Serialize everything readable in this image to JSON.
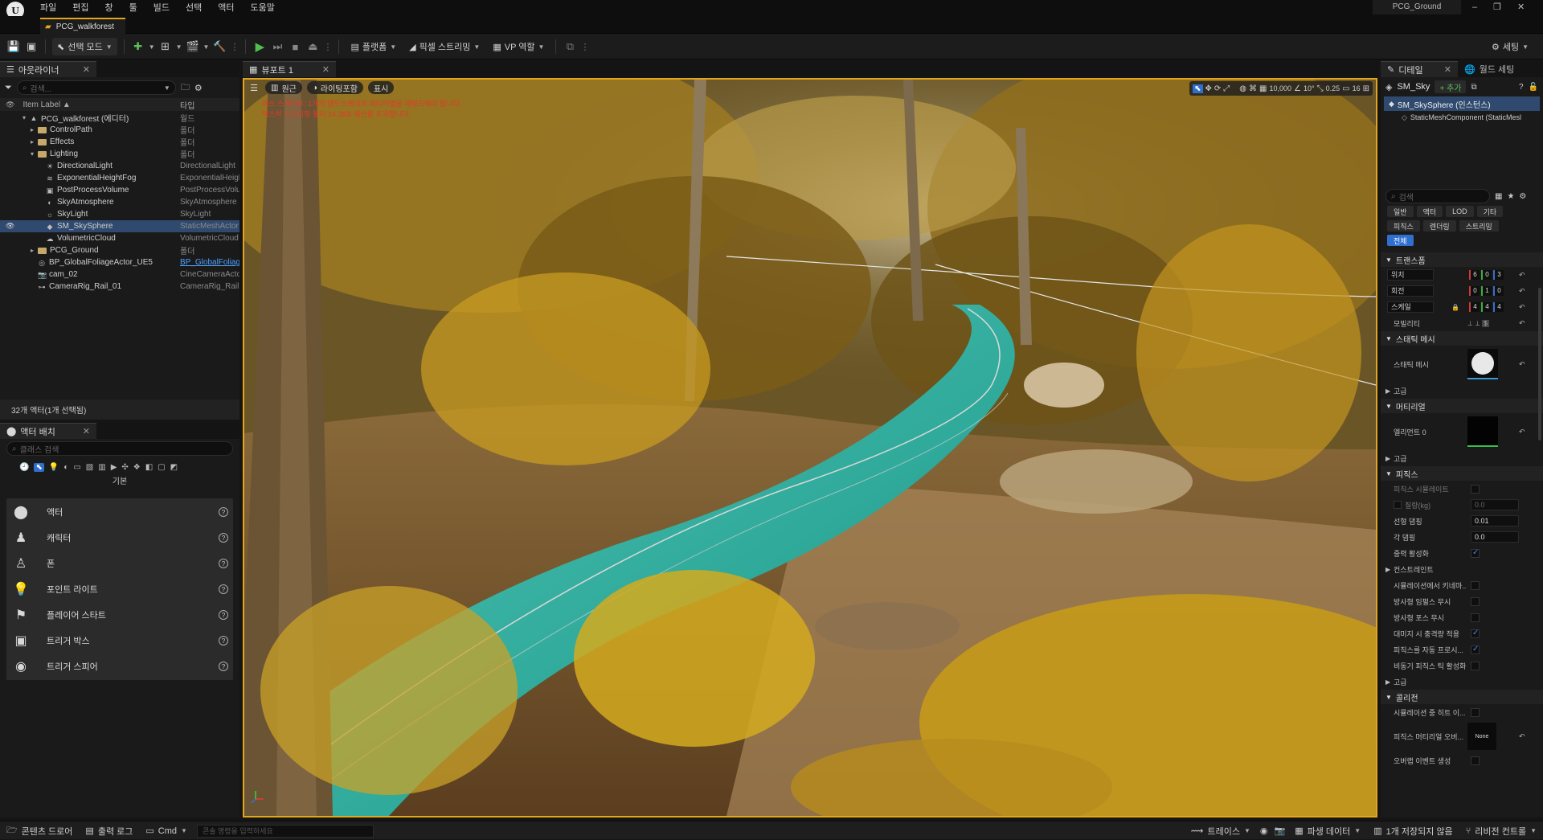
{
  "menu": {
    "items": [
      "파일",
      "편집",
      "창",
      "툴",
      "빌드",
      "선택",
      "액터",
      "도움말"
    ]
  },
  "window": {
    "project_name": "PCG_Ground",
    "level_tab": "PCG_walkforest"
  },
  "toolbar": {
    "select_mode": "선택 모드",
    "platforms": "플랫폼",
    "pixel_streaming": "픽셀 스트리밍",
    "vp_role": "VP 역할",
    "settings": "세팅"
  },
  "outliner": {
    "tab_label": "아웃라이너",
    "search_placeholder": "검색...",
    "col_label": "Item Label ▲",
    "col_type": "타입",
    "rows": [
      {
        "label": "PCG_walkforest (에디터)",
        "type": "월드",
        "indent": 1,
        "icon": "world",
        "exp": "▾"
      },
      {
        "label": "ControlPath",
        "type": "폴더",
        "indent": 2,
        "icon": "folder",
        "exp": "▸"
      },
      {
        "label": "Effects",
        "type": "폴더",
        "indent": 2,
        "icon": "folder",
        "exp": "▸"
      },
      {
        "label": "Lighting",
        "type": "폴더",
        "indent": 2,
        "icon": "folder",
        "exp": "▾"
      },
      {
        "label": "DirectionalLight",
        "type": "DirectionalLight",
        "indent": 3,
        "icon": "light",
        "exp": ""
      },
      {
        "label": "ExponentialHeightFog",
        "type": "ExponentialHeigh",
        "indent": 3,
        "icon": "fog",
        "exp": ""
      },
      {
        "label": "PostProcessVolume",
        "type": "PostProcessVolu",
        "indent": 3,
        "icon": "volume",
        "exp": ""
      },
      {
        "label": "SkyAtmosphere",
        "type": "SkyAtmosphere",
        "indent": 3,
        "icon": "sky",
        "exp": ""
      },
      {
        "label": "SkyLight",
        "type": "SkyLight",
        "indent": 3,
        "icon": "skylight",
        "exp": ""
      },
      {
        "label": "SM_SkySphere",
        "type": "StaticMeshActor",
        "indent": 3,
        "icon": "mesh",
        "exp": "",
        "selected": true
      },
      {
        "label": "VolumetricCloud",
        "type": "VolumetricCloud",
        "indent": 3,
        "icon": "cloud",
        "exp": ""
      },
      {
        "label": "PCG_Ground",
        "type": "폴더",
        "indent": 2,
        "icon": "folder",
        "exp": "▸"
      },
      {
        "label": "BP_GlobalFoliageActor_UE5",
        "type": "BP_GlobalFoliage",
        "indent": 2,
        "icon": "actor",
        "exp": "",
        "link": true
      },
      {
        "label": "cam_02",
        "type": "CineCameraActor",
        "indent": 2,
        "icon": "camera",
        "exp": ""
      },
      {
        "label": "CameraRig_Rail_01",
        "type": "CameraRig_Rail",
        "indent": 2,
        "icon": "rail",
        "exp": ""
      }
    ],
    "status": "32개 액터(1개 선택됨)"
  },
  "place_actors": {
    "tab_label": "액터 배치",
    "search_placeholder": "클래스 검색",
    "category": "기본",
    "items": [
      {
        "label": "액터",
        "icon": "sphere"
      },
      {
        "label": "캐릭터",
        "icon": "character"
      },
      {
        "label": "폰",
        "icon": "pawn"
      },
      {
        "label": "포인트 라이트",
        "icon": "bulb"
      },
      {
        "label": "플레이어 스타트",
        "icon": "flag"
      },
      {
        "label": "트리거 박스",
        "icon": "box"
      },
      {
        "label": "트리거 스피어",
        "icon": "sphere2"
      }
    ]
  },
  "viewport": {
    "tab_label": "뷰포트 1",
    "perspective": "원근",
    "lighting": "라이팅포함",
    "show": "표시",
    "warning_line1": "래스 스케이프: 1개의 랜드스케이프 머티리얼을 재빌드해야 합니다.",
    "warning_line2": "텍스처 스트리밍 풀이 14.2KB 예산을 초과합니다.",
    "grid_snap": "10,000",
    "rot_snap": "10°",
    "scale_snap": "0.25",
    "cam_speed": "16"
  },
  "details": {
    "tab_label": "디테일",
    "world_settings_tab": "월드 세팅",
    "actor_name": "SM_Sky",
    "add_button": "+ 추가",
    "component_root": "SM_SkySphere (인스턴스)",
    "component_child": "StaticMeshComponent (StaticMesl",
    "search_placeholder": "검색",
    "filters_row1": [
      "일반",
      "액터",
      "LOD",
      "기타"
    ],
    "filters_row2": [
      "피직스",
      "렌더링",
      "스트리밍"
    ],
    "filter_all": "전체",
    "transform": {
      "title": "트랜스폼",
      "rows": [
        {
          "label": "위치",
          "values": [
            "6",
            "0",
            "3"
          ]
        },
        {
          "label": "회전",
          "values": [
            "0",
            "1",
            "0"
          ]
        },
        {
          "label": "스케일",
          "values": [
            "4",
            "4",
            "4"
          ]
        }
      ],
      "mobility": "모빌리티"
    },
    "static_mesh": {
      "title": "스태틱 메시",
      "label": "스태틱 메시",
      "advanced": "고급"
    },
    "materials": {
      "title": "머티리얼",
      "element0": "엘리먼트 0",
      "advanced": "고급"
    },
    "physics": {
      "title": "피직스",
      "simulate": "피직스 시뮬레이트",
      "mass": "질량(kg)",
      "mass_val": "0.0",
      "linear_damping": "선형 댐핑",
      "linear_damping_val": "0.01",
      "angular_damping": "각 댐핑",
      "angular_damping_val": "0.0",
      "gravity": "중력 활성화",
      "constraints": "컨스트레인트",
      "props": [
        {
          "label": "시뮬레이션에서 키네마...",
          "on": false
        },
        {
          "label": "방사형 임펄스 무시",
          "on": false
        },
        {
          "label": "방사형 포스 무시",
          "on": false
        },
        {
          "label": "대미지 시 충격량 적용",
          "on": true
        },
        {
          "label": "피직스를 자동 프로시...",
          "on": true
        },
        {
          "label": "비동기 피직스 틱 활성화",
          "on": false
        }
      ],
      "advanced": "고급"
    },
    "collision": {
      "title": "콜리전",
      "hit_event": "시뮬레이션 중 히트 이...",
      "phys_mat": "피직스 머티리얼 오버...",
      "phys_mat_val": "None",
      "overlap": "오버랩 이벤트 생성"
    }
  },
  "statusbar": {
    "content_drawer": "콘텐츠 드로어",
    "output_log": "출력 로그",
    "cmd": "Cmd",
    "console_placeholder": "콘솔 명령을 입력하세요",
    "trace": "트레이스",
    "derived_data": "파생 데이터",
    "unsaved": "1개 저장되지 않음",
    "revision": "리비전 컨트롤"
  },
  "colors": {
    "accent": "#e3a51c",
    "selection": "#2f4a6e",
    "link": "#4ea1ff",
    "play": "#4fc04f"
  }
}
